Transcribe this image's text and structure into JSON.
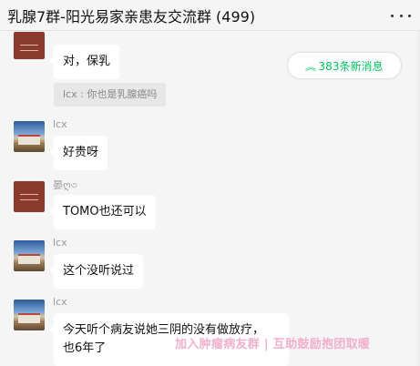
{
  "header": {
    "title": "乳腺7群-阳光易家亲患友交流群 (499)"
  },
  "unread": {
    "label": "383条新消息"
  },
  "messages": [
    {
      "sender": "",
      "text": "对，保乳"
    },
    {
      "sender": "lcx",
      "text": "好贵呀"
    },
    {
      "sender": "晏ღ৩",
      "text": "TOMO也还可以"
    },
    {
      "sender": "lcx",
      "text": "这个没听说过"
    },
    {
      "sender": "lcx",
      "text_line1": "今天听个病友说她三阴的没有做放疗，",
      "text_line2": "也6年了"
    }
  ],
  "quote": {
    "text": "lcx : 你也是乳腺癌吗"
  },
  "watermark": {
    "text": "加入肿瘤病友群 | 互助鼓励抱团取暖"
  }
}
